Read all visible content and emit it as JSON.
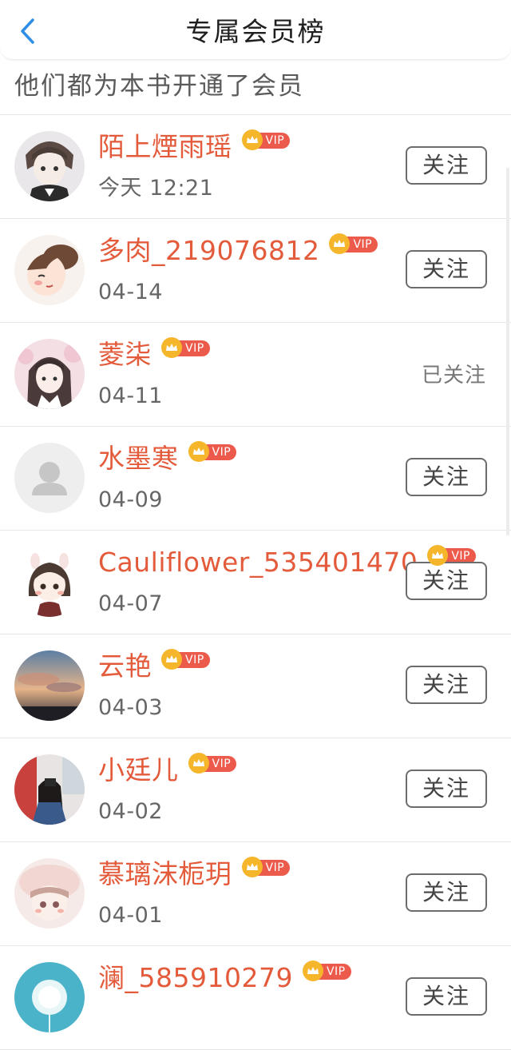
{
  "header": {
    "title": "专属会员榜",
    "back_icon": "chevron-left-icon",
    "accent_color": "#2f8fe6"
  },
  "subtitle": "他们都为本书开通了会员",
  "vip_badge_text": "VIP",
  "members": [
    {
      "name": "陌上煙雨瑶",
      "date": "今天 12:21",
      "action": "关注",
      "followed": false,
      "avatar": "anime-boy-avatar"
    },
    {
      "name": "多肉_219076812",
      "date": "04-14",
      "action": "关注",
      "followed": false,
      "avatar": "cartoon-girl-avatar"
    },
    {
      "name": "菱柒",
      "date": "04-11",
      "action": "已关注",
      "followed": true,
      "avatar": "anime-character-avatar"
    },
    {
      "name": "水墨寒",
      "date": "04-09",
      "action": "关注",
      "followed": false,
      "avatar": "default-user-avatar"
    },
    {
      "name": "Cauliflower_535401470",
      "date": "04-07",
      "action": "关注",
      "followed": false,
      "avatar": "chibi-girl-avatar"
    },
    {
      "name": "云艳",
      "date": "04-03",
      "action": "关注",
      "followed": false,
      "avatar": "sunset-sky-avatar"
    },
    {
      "name": "小廷儿",
      "date": "04-02",
      "action": "关注",
      "followed": false,
      "avatar": "girl-photo-avatar"
    },
    {
      "name": "慕璃沫栀玥",
      "date": "04-01",
      "action": "关注",
      "followed": false,
      "avatar": "pink-hat-girl-avatar"
    },
    {
      "name": "澜_585910279",
      "date": "",
      "action": "关注",
      "followed": false,
      "avatar": "dandelion-avatar"
    }
  ],
  "colors": {
    "name": "#e35b3b",
    "vip_badge": "#ec5a4c",
    "crown": "#f5b62b"
  }
}
